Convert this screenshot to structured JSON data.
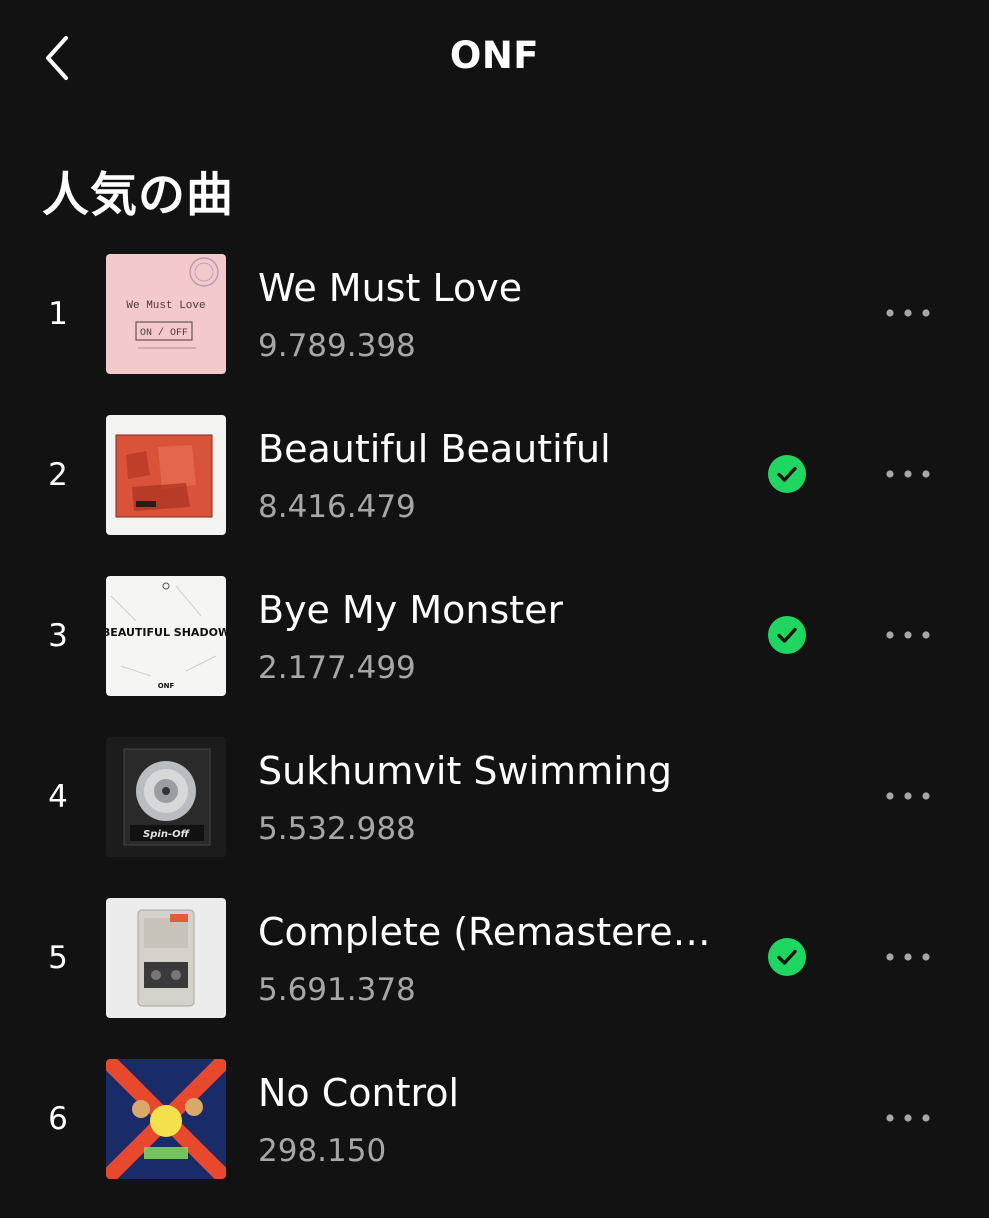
{
  "header": {
    "title": "ONF",
    "back_icon": "chevron-left-icon"
  },
  "section": {
    "title": "人気の曲"
  },
  "colors": {
    "background": "#121212",
    "text_primary": "#ffffff",
    "text_secondary": "#a7a7a7",
    "saved_green": "#1ed760"
  },
  "tracks": [
    {
      "rank": "1",
      "title": "We Must Love",
      "plays": "9.789.398",
      "saved": false,
      "art_icon": "album-art-we-must-love"
    },
    {
      "rank": "2",
      "title": "Beautiful Beautiful",
      "plays": "8.416.479",
      "saved": true,
      "art_icon": "album-art-beautiful-beautiful"
    },
    {
      "rank": "3",
      "title": "Bye My Monster",
      "plays": "2.177.499",
      "saved": true,
      "art_icon": "album-art-beautiful-shadow"
    },
    {
      "rank": "4",
      "title": "Sukhumvit Swimming",
      "plays": "5.532.988",
      "saved": false,
      "art_icon": "album-art-spin-off"
    },
    {
      "rank": "5",
      "title": "Complete (Remastered...",
      "plays": "5.691.378",
      "saved": true,
      "art_icon": "album-art-complete"
    },
    {
      "rank": "6",
      "title": "No Control",
      "plays": "298.150",
      "saved": false,
      "art_icon": "album-art-no-control"
    }
  ],
  "album_art_text": {
    "we_must_love": "We Must Love",
    "on_off": "ON / OFF",
    "beautiful_shadow": "BEAUTIFUL SHADOW",
    "onf": "ONF",
    "spin_off": "Spin-Off"
  }
}
